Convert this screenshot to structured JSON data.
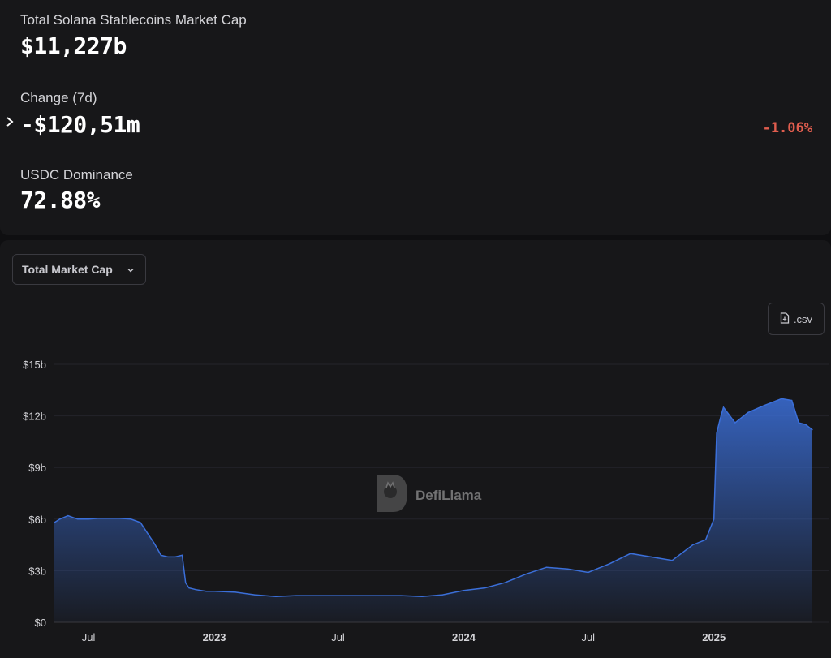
{
  "stats": {
    "total_label": "Total Solana Stablecoins Market Cap",
    "total_value": "$11,227b",
    "change_label": "Change (7d)",
    "change_value": "-$120,51m",
    "change_pct": "-1.06%",
    "dominance_label": "USDC Dominance",
    "dominance_value": "72.88%"
  },
  "controls": {
    "dropdown_label": "Total Market Cap",
    "csv_label": ".csv"
  },
  "watermark": {
    "text": "DefiLlama"
  },
  "colors": {
    "line": "#3b6fd9",
    "negative": "#e05d4e"
  },
  "chart_data": {
    "type": "area",
    "xlabel": "",
    "ylabel": "",
    "x_ticks": [
      "Jul",
      "2023",
      "Jul",
      "2024",
      "Jul",
      "2025"
    ],
    "y_ticks": [
      "$0",
      "$3b",
      "$6b",
      "$9b",
      "$12b",
      "$15b"
    ],
    "ylim": [
      0,
      15
    ],
    "y_unit": "billions USD",
    "grid": true,
    "series": [
      {
        "x": [
          "2022-05-12",
          "2022-05-20",
          "2022-06-01",
          "2022-06-15",
          "2022-07-01",
          "2022-07-15",
          "2022-08-01",
          "2022-08-15",
          "2022-09-01",
          "2022-09-15",
          "2022-09-25",
          "2022-10-05",
          "2022-10-15",
          "2022-10-25",
          "2022-11-05",
          "2022-11-15",
          "2022-11-20",
          "2022-11-25",
          "2022-12-05",
          "2022-12-20",
          "2023-01-01",
          "2023-02-01",
          "2023-03-01",
          "2023-04-01",
          "2023-05-01",
          "2023-06-01",
          "2023-07-01",
          "2023-08-01",
          "2023-09-01",
          "2023-10-01",
          "2023-11-01",
          "2023-12-01",
          "2024-01-01",
          "2024-02-01",
          "2024-03-01",
          "2024-04-01",
          "2024-05-01",
          "2024-06-01",
          "2024-07-01",
          "2024-08-01",
          "2024-09-01",
          "2024-10-01",
          "2024-11-01",
          "2024-12-01",
          "2024-12-20",
          "2025-01-01",
          "2025-01-05",
          "2025-01-10",
          "2025-01-15",
          "2025-02-01",
          "2025-02-20",
          "2025-03-15",
          "2025-04-10",
          "2025-04-25",
          "2025-05-05",
          "2025-05-15",
          "2025-05-25"
        ],
        "values": [
          5.8,
          6.0,
          6.2,
          6.0,
          6.0,
          6.05,
          6.05,
          6.05,
          6.0,
          5.8,
          5.2,
          4.6,
          3.9,
          3.8,
          3.8,
          3.9,
          2.3,
          2.0,
          1.9,
          1.8,
          1.8,
          1.75,
          1.6,
          1.5,
          1.55,
          1.55,
          1.55,
          1.55,
          1.55,
          1.55,
          1.5,
          1.6,
          1.85,
          2.0,
          2.3,
          2.8,
          3.2,
          3.1,
          2.9,
          3.4,
          4.0,
          3.8,
          3.6,
          4.5,
          4.8,
          6.0,
          11.0,
          11.8,
          12.5,
          11.6,
          12.2,
          12.6,
          13.0,
          12.9,
          11.6,
          11.5,
          11.2
        ]
      }
    ]
  }
}
